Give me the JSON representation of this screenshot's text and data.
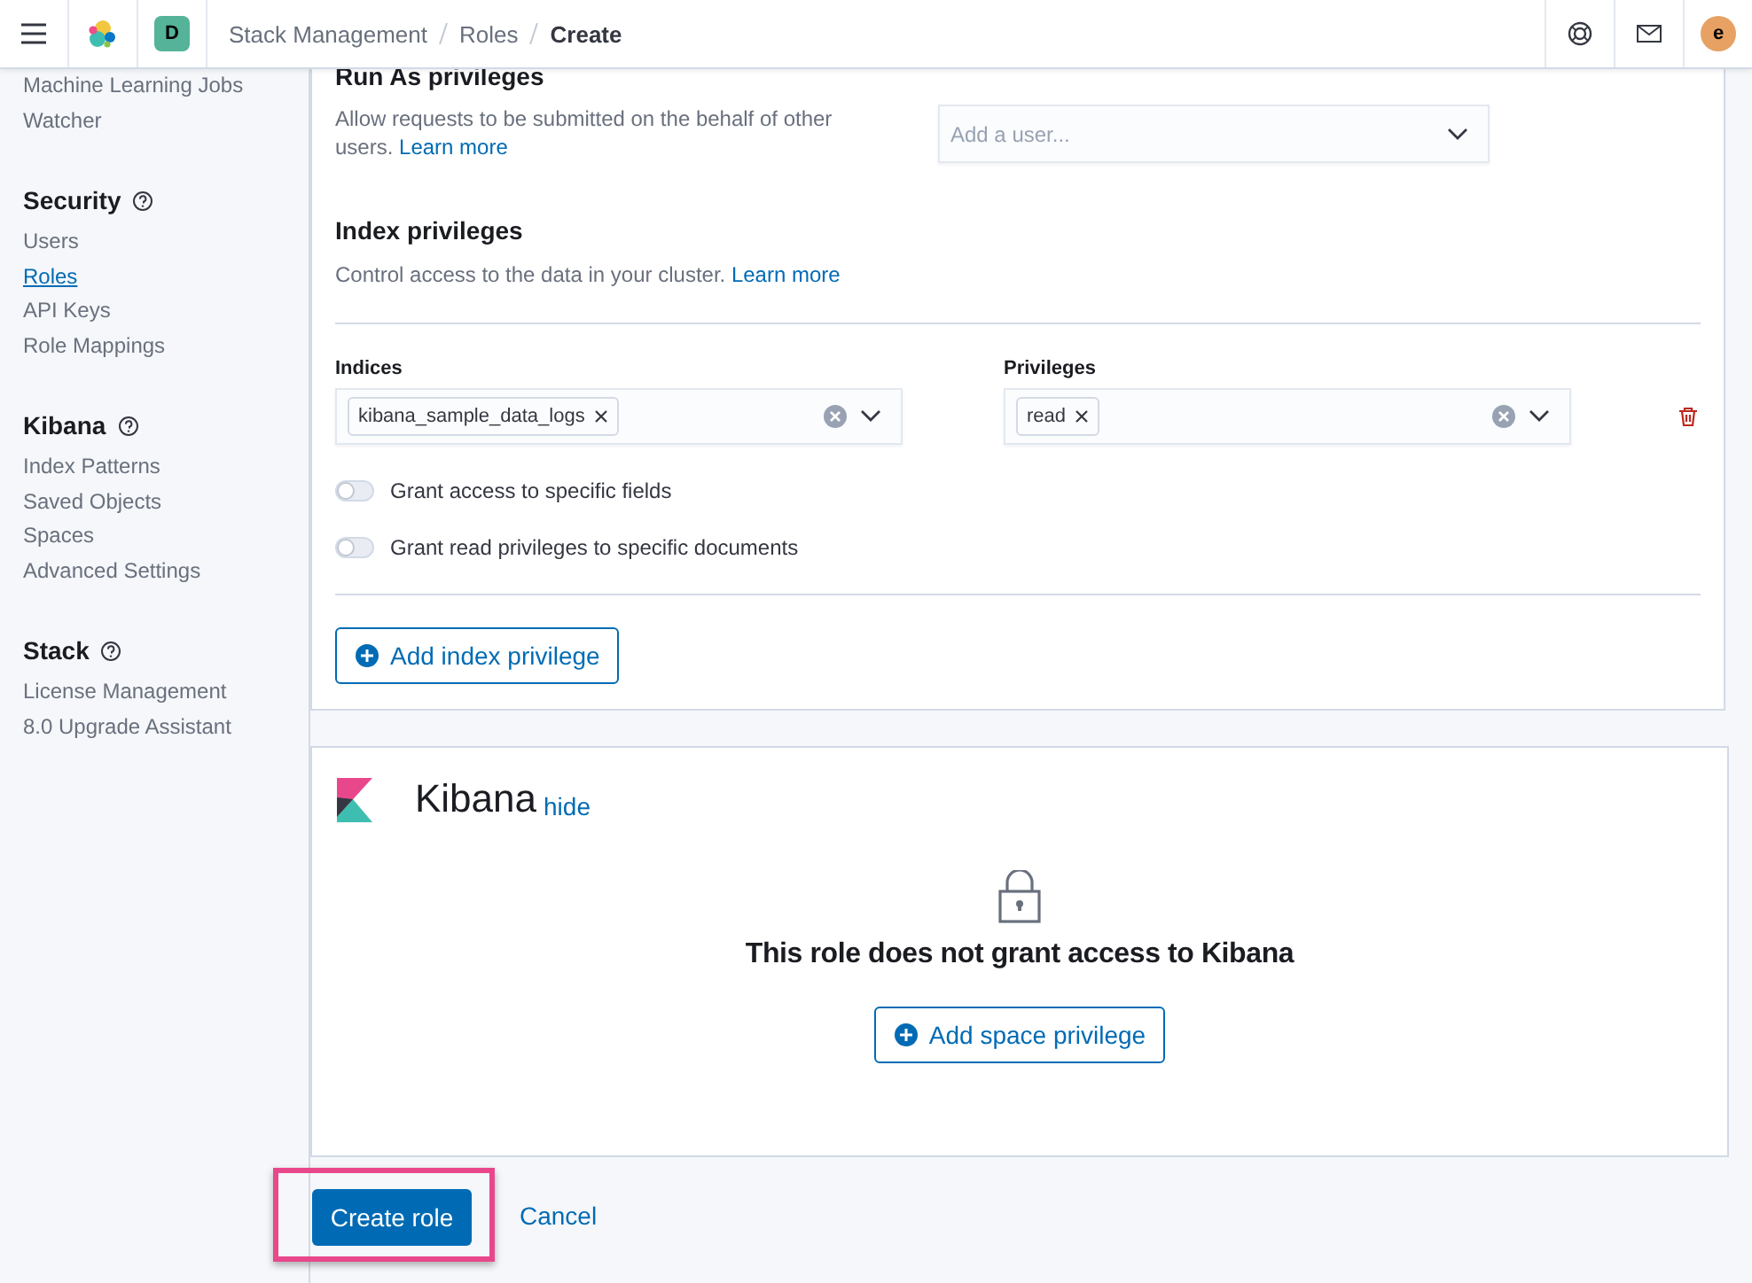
{
  "header": {
    "breadcrumbs": [
      {
        "label": "Stack Management",
        "current": false
      },
      {
        "label": "Roles",
        "current": false
      },
      {
        "label": "Create",
        "current": true
      }
    ],
    "space_badge": "D",
    "avatar": "e"
  },
  "sidebar": {
    "sections": [
      {
        "items": [
          {
            "label": "Machine Learning Jobs",
            "selected": false
          },
          {
            "label": "Watcher",
            "selected": false
          }
        ]
      },
      {
        "title": "Security",
        "items": [
          {
            "label": "Users",
            "selected": false
          },
          {
            "label": "Roles",
            "selected": true
          },
          {
            "label": "API Keys",
            "selected": false
          },
          {
            "label": "Role Mappings",
            "selected": false
          }
        ]
      },
      {
        "title": "Kibana",
        "items": [
          {
            "label": "Index Patterns",
            "selected": false
          },
          {
            "label": "Saved Objects",
            "selected": false
          },
          {
            "label": "Spaces",
            "selected": false
          },
          {
            "label": "Advanced Settings",
            "selected": false
          }
        ]
      },
      {
        "title": "Stack",
        "items": [
          {
            "label": "License Management",
            "selected": false
          },
          {
            "label": "8.0 Upgrade Assistant",
            "selected": false
          }
        ]
      }
    ]
  },
  "run_as": {
    "title": "Run As privileges",
    "description": "Allow requests to be submitted on the behalf of other users.",
    "link": "Learn more",
    "select": {
      "placeholder": "Add a user..."
    }
  },
  "index_privileges": {
    "title": "Index privileges",
    "description": "Control access to the data in your cluster.",
    "link": "Learn more",
    "row": {
      "indices_label": "Indices",
      "indices": [
        "kibana_sample_data_logs"
      ],
      "privileges_label": "Privileges",
      "privileges": [
        "read"
      ]
    },
    "toggles": [
      {
        "label": "Grant access to specific fields",
        "on": false
      },
      {
        "label": "Grant read privileges to specific documents",
        "on": false
      }
    ],
    "add_button": "Add index privilege"
  },
  "kibana": {
    "title": "Kibana",
    "hide_link": "hide",
    "message": "This role does not grant access to Kibana",
    "add_button": "Add space privilege"
  },
  "footer": {
    "primary": "Create role",
    "cancel": "Cancel",
    "highlighted": true
  }
}
